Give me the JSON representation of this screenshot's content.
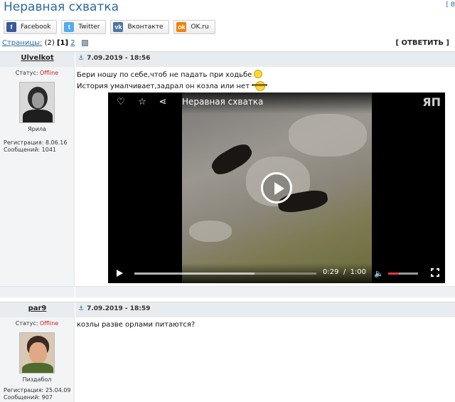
{
  "topic": {
    "title": "Неравная схватка",
    "corner_link": "[ В"
  },
  "share": [
    {
      "icon": "facebook-icon",
      "glyph": "f",
      "label": "Facebook"
    },
    {
      "icon": "twitter-icon",
      "glyph": "t",
      "label": "Twitter"
    },
    {
      "icon": "vk-icon",
      "glyph": "vk",
      "label": "Вконтакте"
    },
    {
      "icon": "ok-icon",
      "glyph": "ok",
      "label": "OK.ru"
    }
  ],
  "pagination": {
    "label": "Страницы:",
    "count": "(2)",
    "current": "[1]",
    "next": "2"
  },
  "reply_label": "[ ОТВЕТИТЬ ]",
  "posts": [
    {
      "author": "Ulvelkot",
      "date": "7.09.2019 - 18:56",
      "status_label": "Статус:",
      "status_value": "Offline",
      "nick_caption": "Ярила",
      "registration": "Регистрация: 8.06.16",
      "messages": "Сообщений: 1041",
      "line1": "Бери ношу по себе,чтоб не падать при ходьбе",
      "line2": "История умалчивает,задрал он козла или нет",
      "video": {
        "title": "Неравная схватка",
        "logo": "ЯП",
        "time_current": "0:29",
        "time_sep": "/",
        "time_total": "1:00",
        "progress": 0.48,
        "buffered": 0.66,
        "volume": 0.35
      }
    },
    {
      "author": "par9",
      "date": "7.09.2019 - 18:59",
      "status_label": "Статус:",
      "status_value": "Offline",
      "nick_caption": "Пиздабол",
      "registration": "Регистрация: 25.04.09",
      "messages": "Сообщений: 907",
      "line1": "козлы разве орлами питаются?"
    }
  ]
}
